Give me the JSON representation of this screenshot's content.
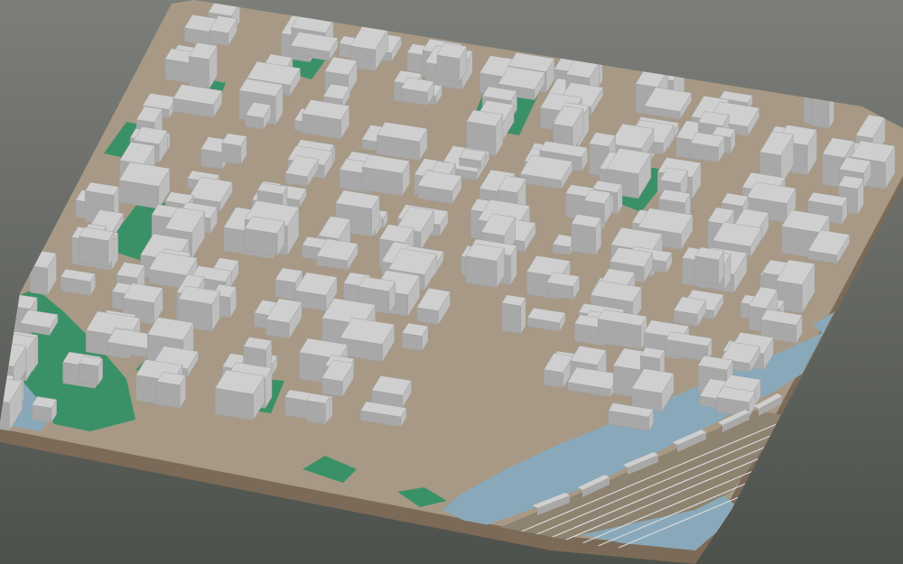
{
  "scene": {
    "subject": "isometric-3d-city-block-model",
    "colors": {
      "background_top": "#7c7e7a",
      "background_bottom": "#4d514c",
      "ground": "#a79985",
      "ground_dark": "#8e8270",
      "base_edge": "#7b6a57",
      "water": "#89a9ba",
      "water_dark": "#6f91a3",
      "park": "#3a9167",
      "park_dark": "#2d7a54",
      "building_top": "#cfcfcf",
      "building_left": "#a8a8a8",
      "building_right": "#bdbdbd",
      "rail": "#d9dadb"
    }
  }
}
